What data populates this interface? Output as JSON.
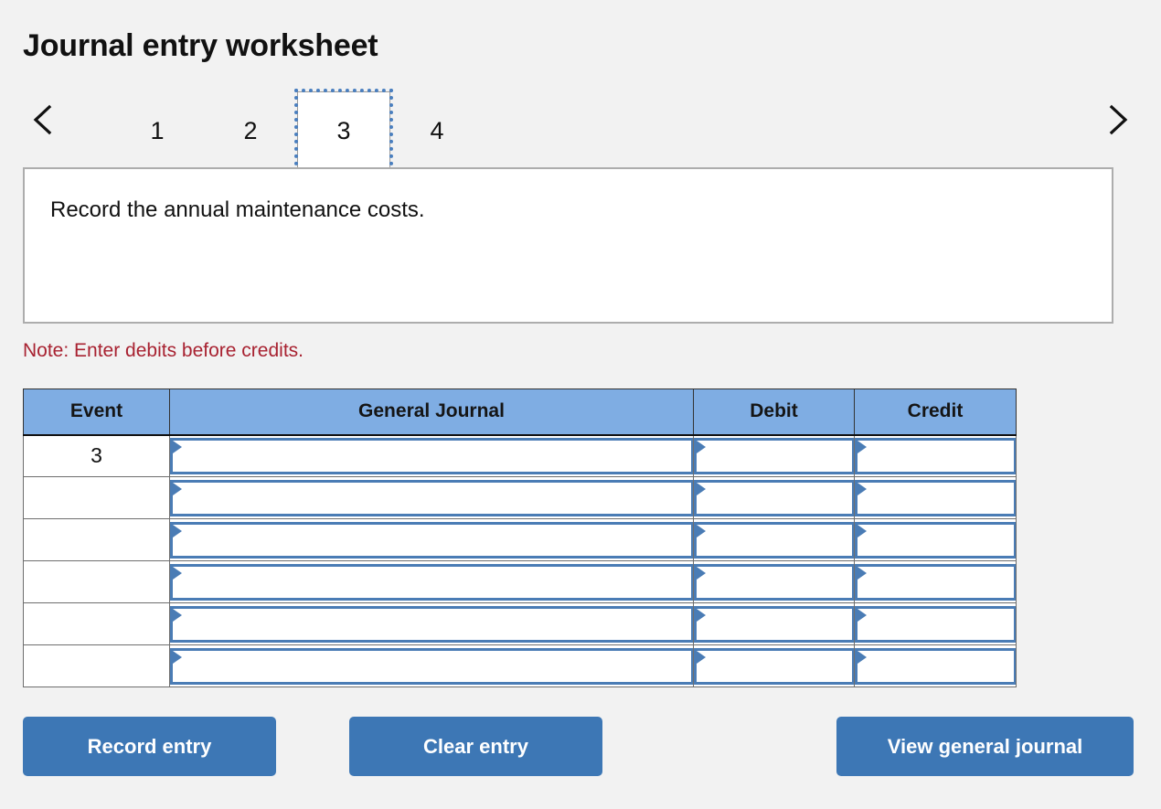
{
  "header": {
    "title": "Journal entry worksheet"
  },
  "pager": {
    "prev_icon": "chevron-left-icon",
    "next_icon": "chevron-right-icon",
    "tabs": [
      {
        "label": "1",
        "active": false
      },
      {
        "label": "2",
        "active": false
      },
      {
        "label": "3",
        "active": true
      },
      {
        "label": "4",
        "active": false
      }
    ],
    "active_tab": "3"
  },
  "prompt": {
    "text": "Record the annual maintenance costs."
  },
  "note": {
    "text": "Note: Enter debits before credits."
  },
  "journal": {
    "columns": [
      "Event",
      "General Journal",
      "Debit",
      "Credit"
    ],
    "rows": [
      {
        "event": "3",
        "general_journal": "",
        "debit": "",
        "credit": ""
      },
      {
        "event": "",
        "general_journal": "",
        "debit": "",
        "credit": ""
      },
      {
        "event": "",
        "general_journal": "",
        "debit": "",
        "credit": ""
      },
      {
        "event": "",
        "general_journal": "",
        "debit": "",
        "credit": ""
      },
      {
        "event": "",
        "general_journal": "",
        "debit": "",
        "credit": ""
      },
      {
        "event": "",
        "general_journal": "",
        "debit": "",
        "credit": ""
      }
    ]
  },
  "actions": {
    "record_label": "Record entry",
    "clear_label": "Clear entry",
    "view_label": "View general journal"
  },
  "colors": {
    "page_background": "#f2f2f2",
    "header_blue": "#7fade3",
    "field_border_blue": "#4a7cb5",
    "button_blue": "#3d77b5",
    "note_red": "#a82231",
    "focus_outline_blue": "#4a7fbf"
  }
}
